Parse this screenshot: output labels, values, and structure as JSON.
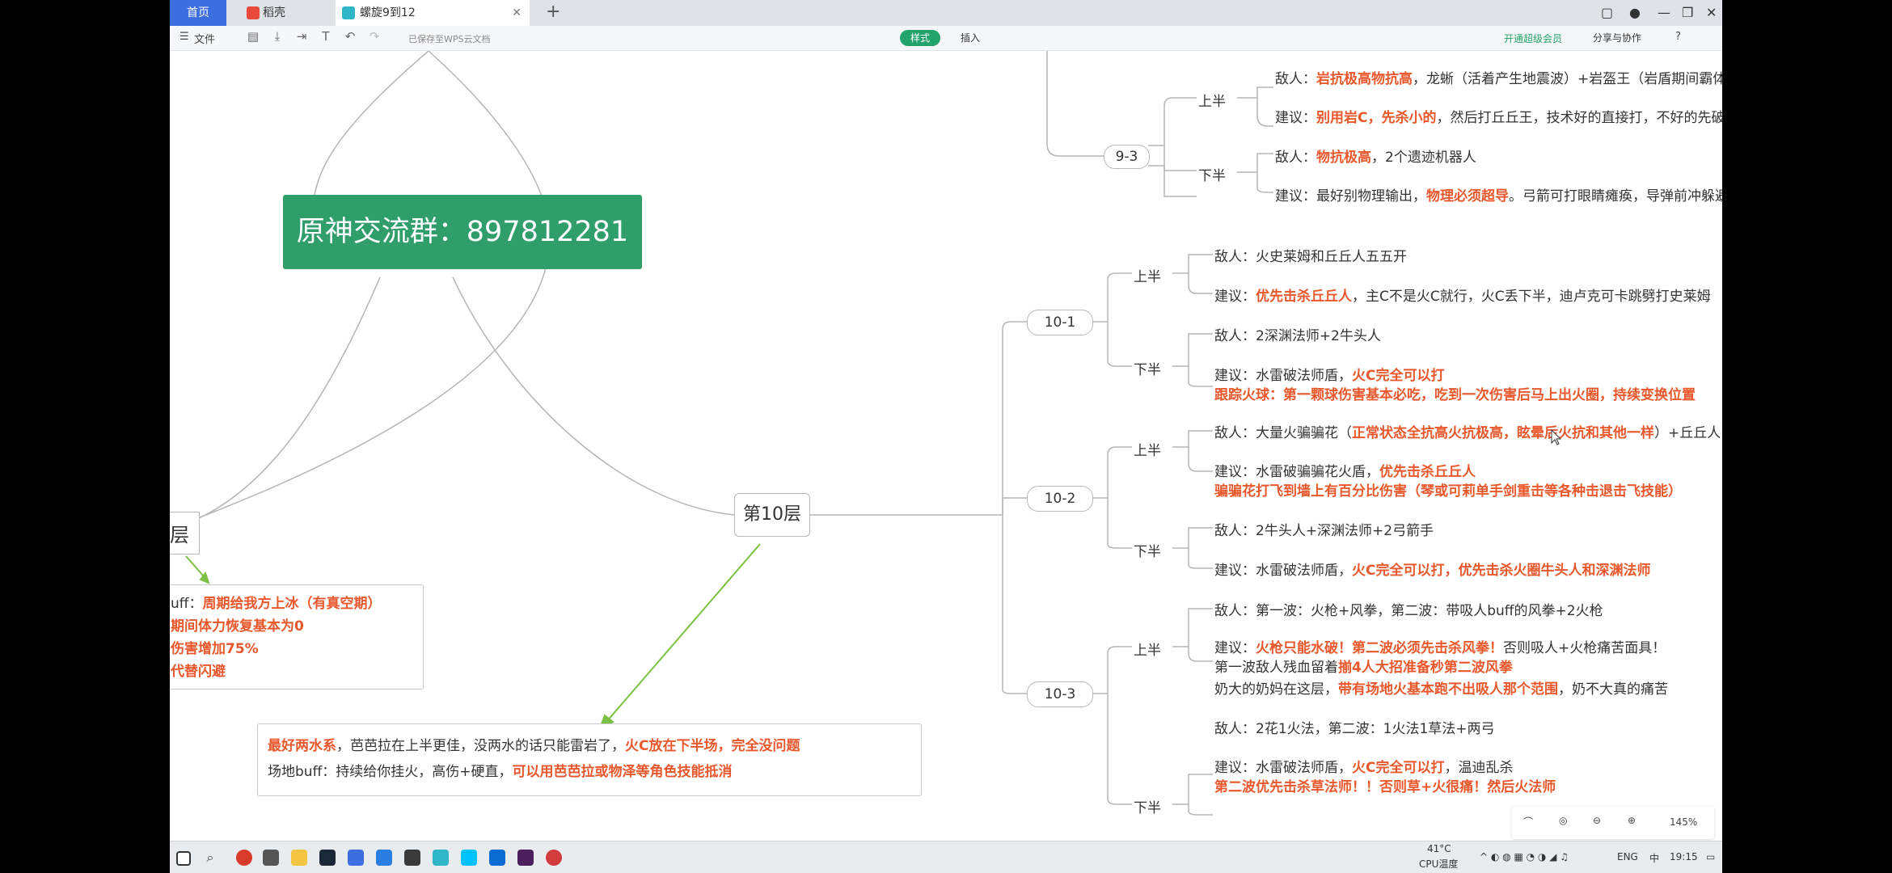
{
  "tabs": {
    "home": "首页",
    "doc": "稻壳",
    "active": "螺旋9到12"
  },
  "toolbar": {
    "file": "文件",
    "saved": "已保存至WPS云文档",
    "style": "样式",
    "insert": "插入",
    "vip": "开通超级会员",
    "share": "分享与协作"
  },
  "mindmap": {
    "qq_group": "原神交流群：897812281",
    "left_fragment": "层",
    "floor10": "第10层",
    "left_box": [
      {
        "parts": [
          {
            "t": "uff：",
            "h": false
          },
          {
            "t": "周期给我方上冰（有真空期）",
            "h": true
          }
        ]
      },
      {
        "parts": [
          {
            "t": "期间体力恢复基本为0",
            "h": true
          }
        ]
      },
      {
        "parts": [
          {
            "t": "伤害增加75%",
            "h": true
          }
        ]
      },
      {
        "parts": [
          {
            "t": "代替闪避",
            "h": true
          }
        ]
      }
    ],
    "bottom_box": [
      {
        "parts": [
          {
            "t": "最好两水系",
            "h": true
          },
          {
            "t": "，芭芭拉在上半更佳，没两水的话只能雷岩了，",
            "h": false
          },
          {
            "t": "火C放在下半场，完全没问题",
            "h": true
          }
        ]
      },
      {
        "parts": [
          {
            "t": "场地buff：持续给你挂火，高伤+硬直，",
            "h": false
          },
          {
            "t": "可以用芭芭拉或物泽等角色技能抵消",
            "h": true
          }
        ]
      }
    ],
    "c93": {
      "label": "9-3",
      "upper": "上半",
      "lower": "下半",
      "u1": [
        {
          "t": "敌人：",
          "h": false
        },
        {
          "t": "岩抗极高物抗高",
          "h": true
        },
        {
          "t": "，龙蜥（活着产生地震波）+岩盔王（岩盾期间霸体+狂暴）",
          "h": false
        }
      ],
      "u2": [
        {
          "t": "建议：",
          "h": false
        },
        {
          "t": "别用岩C，先杀小的",
          "h": true
        },
        {
          "t": "，然后打丘丘王，技术好的直接打，不好的先破岩盾，攻击闪避到他后方",
          "h": false
        }
      ],
      "l1": [
        {
          "t": "敌人：",
          "h": false
        },
        {
          "t": "物抗极高",
          "h": true
        },
        {
          "t": "，2个遗迹机器人",
          "h": false
        }
      ],
      "l2": [
        {
          "t": "建议：最好别物理输出，",
          "h": false
        },
        {
          "t": "物理必须超导",
          "h": true
        },
        {
          "t": "。弓箭可打眼睛瘫痪，导弹前冲躲避",
          "h": false
        }
      ]
    },
    "c101": {
      "label": "10-1",
      "upper": "上半",
      "lower": "下半",
      "u1": [
        {
          "t": "敌人：火史莱姆和丘丘人五五开",
          "h": false
        }
      ],
      "u2": [
        {
          "t": "建议：",
          "h": false
        },
        {
          "t": "优先击杀丘丘人",
          "h": true
        },
        {
          "t": "，主C不是火C就行，火C丢下半，迪卢克可卡跳劈打史莱姆",
          "h": false
        }
      ],
      "l1": [
        {
          "t": "敌人：2深渊法师+2牛头人",
          "h": false
        }
      ],
      "l2": [
        {
          "t": "建议：水雷破法师盾，",
          "h": false
        },
        {
          "t": "火C完全可以打",
          "h": true
        }
      ],
      "l3": [
        {
          "t": "跟踪火球：第一颗球伤害基本必吃，吃到一次伤害后马上出火圈，持续变换位置",
          "h": true
        }
      ]
    },
    "c102": {
      "label": "10-2",
      "upper": "上半",
      "lower": "下半",
      "u1": [
        {
          "t": "敌人：大量火骗骗花（",
          "h": false
        },
        {
          "t": "正常状态全抗高火抗极高，眩晕后火抗和其他一样",
          "h": true
        },
        {
          "t": "）+丘丘人",
          "h": false
        }
      ],
      "u2": [
        {
          "t": "建议：水雷破骗骗花火盾，",
          "h": false
        },
        {
          "t": "优先击杀丘丘人",
          "h": true
        }
      ],
      "u3": [
        {
          "t": "骗骗花打飞到墙上有百分比伤害（琴或可莉单手剑重击等各种击退击飞技能）",
          "h": true
        }
      ],
      "l1": [
        {
          "t": "敌人：2牛头人+深渊法师+2弓箭手",
          "h": false
        }
      ],
      "l2": [
        {
          "t": "建议：水雷破法师盾，",
          "h": false
        },
        {
          "t": "火C完全可以打，优先击杀火圈牛头人和深渊法师",
          "h": true
        }
      ]
    },
    "c103": {
      "label": "10-3",
      "upper": "上半",
      "lower": "下半",
      "u1": [
        {
          "t": "敌人：第一波：火枪+风拳，第二波：带吸人buff的风拳+2火枪",
          "h": false
        }
      ],
      "u2": [
        {
          "t": "建议：",
          "h": false
        },
        {
          "t": "火枪只能水破！第二波必须先击杀风拳！",
          "h": true
        },
        {
          "t": "否则吸人+火枪痛苦面具！",
          "h": false
        }
      ],
      "u3": [
        {
          "t": "第一波敌人残血留着",
          "h": false
        },
        {
          "t": "揃4人大招准备秒第二波风拳",
          "h": true
        }
      ],
      "u4": [
        {
          "t": "奶大的奶妈在这层，",
          "h": false
        },
        {
          "t": "带有场地火基本跑不出吸人那个范围",
          "h": true
        },
        {
          "t": "，奶不大真的痛苦",
          "h": false
        }
      ],
      "l1": [
        {
          "t": "敌人：2花1火法，第二波：1火法1草法+两弓",
          "h": false
        }
      ],
      "l2": [
        {
          "t": "建议：水雷破法师盾，",
          "h": false
        },
        {
          "t": "火C完全可以打",
          "h": true
        },
        {
          "t": "，温迪乱杀",
          "h": false
        }
      ],
      "l3": [
        {
          "t": "第二波优先击杀草法师！！否则草+火很痛！然后火法师",
          "h": true
        }
      ]
    }
  },
  "zoom": {
    "level": "145%"
  },
  "taskbar": {
    "temp": "41°C",
    "cpu": "CPU温度",
    "lang": "ENG",
    "time": "19:15"
  },
  "colors": {
    "accent": "#e8582c",
    "green": "#2f9e6b",
    "arrow": "#7ac143"
  }
}
